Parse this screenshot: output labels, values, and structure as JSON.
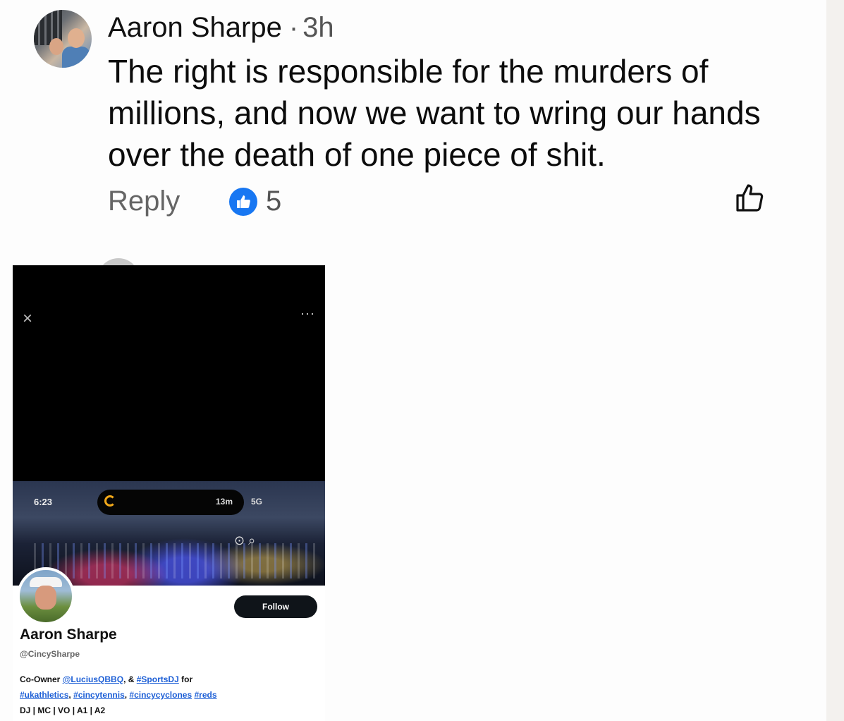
{
  "comment": {
    "author": "Aaron Sharpe",
    "separator": "·",
    "time": "3h",
    "text": "The right is responsible for the murders of millions, and now we want to wring our hands over the death of one piece of shit.",
    "reply_label": "Reply",
    "like_count": "5",
    "colors": {
      "like_badge": "#1877f2",
      "text": "#0c0c0c",
      "muted": "#656565"
    }
  },
  "embedded_screenshot": {
    "close_glyph": "×",
    "more_glyph": "···",
    "status_time": "6:23",
    "island_text": "13m",
    "status_right": "5G",
    "profile": {
      "follow_label": "Follow",
      "name": "Aaron Sharpe",
      "handle": "@CincySharpe",
      "bio": {
        "prefix": "Co-Owner",
        "link1": "@LuciusQBBQ",
        "mid": ", &",
        "link2": "#SportsDJ",
        "for": " for",
        "tags": [
          "#ukathletics",
          "#cincytennis",
          "#cincycyclones",
          "#reds"
        ],
        "roles": "DJ | MC | VO | A1 | A2"
      }
    }
  }
}
